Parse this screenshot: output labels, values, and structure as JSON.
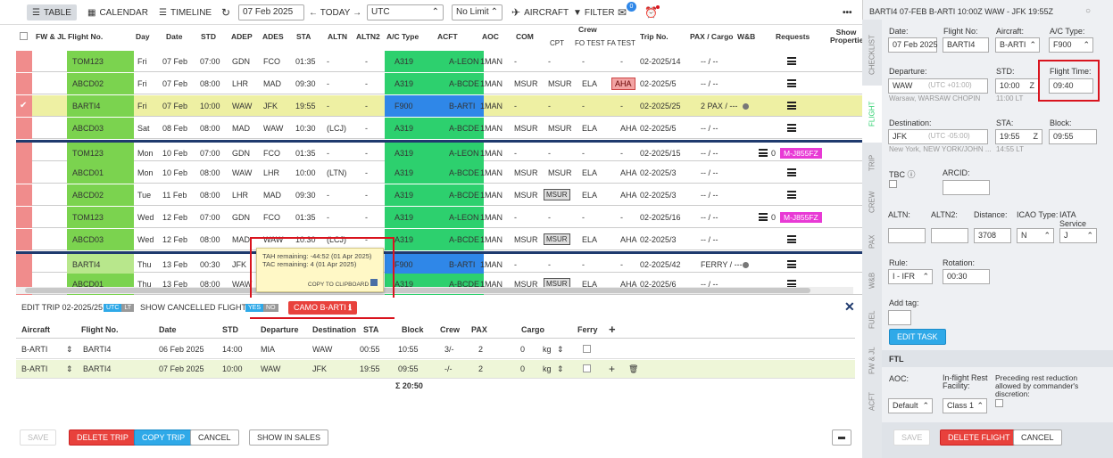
{
  "toolbar": {
    "table": "TABLE",
    "calendar": "CALENDAR",
    "timeline": "TIMELINE",
    "date": "07 Feb 2025",
    "today": "TODAY",
    "tz": "UTC",
    "limit": "No Limit",
    "aircraft": "AIRCRAFT",
    "filter": "FILTER",
    "mail_badge": "0",
    "more": "•••"
  },
  "columns": {
    "fw": "FW & JL",
    "flight": "Flight No.",
    "day": "Day",
    "date": "Date",
    "std": "STD",
    "adep": "ADEP",
    "ades": "ADES",
    "sta": "STA",
    "altn": "ALTN",
    "altn2": "ALTN2",
    "actype": "A/C Type",
    "acft": "ACFT",
    "aoc": "AOC",
    "com": "COM",
    "crew": "Crew",
    "cpt": "CPT",
    "fo": "FO TEST",
    "fa": "FA TEST",
    "trip": "Trip No.",
    "pax": "PAX / Cargo",
    "wb": "W&B",
    "requests": "Requests",
    "show_props": "Show Properties"
  },
  "rows": [
    {
      "flight": "TOM123",
      "day": "Fri",
      "date": "07 Feb",
      "std": "07:00",
      "adep": "GDN",
      "ades": "FCO",
      "sta": "01:35",
      "altn": "-",
      "altn2": "-",
      "type": "A319",
      "acft": "A-LEON",
      "aoc": "1MAN",
      "com": "-",
      "cpt": "-",
      "fo": "-",
      "fa": "-",
      "trip": "02-2025/14",
      "pax": "-- / --",
      "req_count": "",
      "req_tag": ""
    },
    {
      "flight": "ABCD02",
      "day": "Fri",
      "date": "07 Feb",
      "std": "08:00",
      "adep": "LHR",
      "ades": "MAD",
      "sta": "09:30",
      "altn": "-",
      "altn2": "-",
      "type": "A319",
      "acft": "A-BCDE",
      "aoc": "1MAN",
      "com": "MSUR",
      "cpt": "MSUR",
      "fo": "ELA",
      "fa": "AHA",
      "trip": "02-2025/5",
      "pax": "-- / --",
      "req_count": "",
      "req_tag": ""
    },
    {
      "flight": "BARTI4",
      "day": "Fri",
      "date": "07 Feb",
      "std": "10:00",
      "adep": "WAW",
      "ades": "JFK",
      "sta": "19:55",
      "altn": "-",
      "altn2": "-",
      "type": "F900",
      "acft": "B-ARTI",
      "aoc": "1MAN",
      "com": "-",
      "cpt": "-",
      "fo": "-",
      "fa": "-",
      "trip": "02-2025/25",
      "pax": "2 PAX / ---",
      "req_count": "",
      "req_tag": ""
    },
    {
      "flight": "ABCD03",
      "day": "Sat",
      "date": "08 Feb",
      "std": "08:00",
      "adep": "MAD",
      "ades": "WAW",
      "sta": "10:30",
      "altn": "(LCJ)",
      "altn2": "-",
      "type": "A319",
      "acft": "A-BCDE",
      "aoc": "1MAN",
      "com": "MSUR",
      "cpt": "MSUR",
      "fo": "ELA",
      "fa": "AHA",
      "trip": "02-2025/5",
      "pax": "-- / --",
      "req_count": "",
      "req_tag": ""
    },
    {
      "flight": "TOM123",
      "day": "Mon",
      "date": "10 Feb",
      "std": "07:00",
      "adep": "GDN",
      "ades": "FCO",
      "sta": "01:35",
      "altn": "-",
      "altn2": "-",
      "type": "A319",
      "acft": "A-LEON",
      "aoc": "1MAN",
      "com": "-",
      "cpt": "-",
      "fo": "-",
      "fa": "-",
      "trip": "02-2025/15",
      "pax": "-- / --",
      "req_count": "0",
      "req_tag": "M-J855FZ"
    },
    {
      "flight": "ABCD01",
      "day": "Mon",
      "date": "10 Feb",
      "std": "08:00",
      "adep": "WAW",
      "ades": "LHR",
      "sta": "10:00",
      "altn": "(LTN)",
      "altn2": "-",
      "type": "A319",
      "acft": "A-BCDE",
      "aoc": "1MAN",
      "com": "MSUR",
      "cpt": "MSUR",
      "fo": "ELA",
      "fa": "AHA",
      "trip": "02-2025/3",
      "pax": "-- / --",
      "req_count": "",
      "req_tag": ""
    },
    {
      "flight": "ABCD02",
      "day": "Tue",
      "date": "11 Feb",
      "std": "08:00",
      "adep": "LHR",
      "ades": "MAD",
      "sta": "09:30",
      "altn": "-",
      "altn2": "-",
      "type": "A319",
      "acft": "A-BCDE",
      "aoc": "1MAN",
      "com": "MSUR",
      "cpt": "MSUR",
      "fo": "ELA",
      "fa": "AHA",
      "trip": "02-2025/3",
      "pax": "-- / --",
      "req_count": "",
      "req_tag": ""
    },
    {
      "flight": "TOM123",
      "day": "Wed",
      "date": "12 Feb",
      "std": "07:00",
      "adep": "GDN",
      "ades": "FCO",
      "sta": "01:35",
      "altn": "-",
      "altn2": "-",
      "type": "A319",
      "acft": "A-LEON",
      "aoc": "1MAN",
      "com": "-",
      "cpt": "-",
      "fo": "-",
      "fa": "-",
      "trip": "02-2025/16",
      "pax": "-- / --",
      "req_count": "0",
      "req_tag": "M-J855FZ"
    },
    {
      "flight": "ABCD03",
      "day": "Wed",
      "date": "12 Feb",
      "std": "08:00",
      "adep": "MAD",
      "ades": "WAW",
      "sta": "10:30",
      "altn": "(LCJ)",
      "altn2": "-",
      "type": "A319",
      "acft": "A-BCDE",
      "aoc": "1MAN",
      "com": "MSUR",
      "cpt": "MSUR",
      "fo": "ELA",
      "fa": "AHA",
      "trip": "02-2025/3",
      "pax": "-- / --",
      "req_count": "",
      "req_tag": ""
    },
    {
      "flight": "BARTI4",
      "day": "Thu",
      "date": "13 Feb",
      "std": "00:30",
      "adep": "JFK",
      "ades": "",
      "sta": "",
      "altn": "",
      "altn2": "",
      "type": "F900",
      "acft": "B-ARTI",
      "aoc": "1MAN",
      "com": "-",
      "cpt": "-",
      "fo": "-",
      "fa": "-",
      "trip": "02-2025/42",
      "pax": "FERRY / ---",
      "req_count": "",
      "req_tag": ""
    },
    {
      "flight": "ABCD01",
      "day": "Thu",
      "date": "13 Feb",
      "std": "08:00",
      "adep": "WAW",
      "ades": "",
      "sta": "",
      "altn": "",
      "altn2": "",
      "type": "A319",
      "acft": "A-BCDE",
      "aoc": "1MAN",
      "com": "MSUR",
      "cpt": "MSUR",
      "fo": "ELA",
      "fa": "AHA",
      "trip": "02-2025/6",
      "pax": "-- / --",
      "req_count": "",
      "req_tag": ""
    }
  ],
  "tooltip": {
    "line1": "TAH remaining: -44:52 (01 Apr 2025)",
    "line2": "TAC remaining: 4 (01 Apr 2025)",
    "copy": "COPY TO CLIPBOARD"
  },
  "edit": {
    "title": "EDIT TRIP 02-2025/25",
    "utc": "UTC",
    "lt": "LT",
    "show_cancelled": "SHOW CANCELLED FLIGHTS",
    "yes": "YES",
    "no": "NO",
    "camo": "CAMO B-ARTI",
    "headers": {
      "aircraft": "Aircraft",
      "flight": "Flight No.",
      "date": "Date",
      "std": "STD",
      "departure": "Departure",
      "destination": "Destination",
      "sta": "STA",
      "block": "Block",
      "crew": "Crew",
      "pax": "PAX",
      "cargo": "Cargo",
      "ferry": "Ferry"
    },
    "rows": [
      {
        "aircraft": "B-ARTI",
        "flight": "BARTI4",
        "date": "06 Feb 2025",
        "std": "14:00",
        "dep": "MIA",
        "dest": "WAW",
        "sta": "00:55",
        "block": "10:55",
        "crew": "3/-",
        "pax": "2",
        "cargo": "0",
        "unit": "kg"
      },
      {
        "aircraft": "B-ARTI",
        "flight": "BARTI4",
        "date": "07 Feb 2025",
        "std": "10:00",
        "dep": "WAW",
        "dest": "JFK",
        "sta": "19:55",
        "block": "09:55",
        "crew": "-/-",
        "pax": "2",
        "cargo": "0",
        "unit": "kg"
      }
    ],
    "total": "Σ 20:50"
  },
  "buttons": {
    "save": "SAVE",
    "delete_trip": "DELETE TRIP",
    "copy_trip": "COPY TRIP",
    "cancel": "CANCEL",
    "show_in_sales": "SHOW IN SALES"
  },
  "panel": {
    "title": "BARTI4 07-FEB B-ARTI 10:00Z WAW - JFK 19:55Z",
    "tabs": [
      "CHECKLIST",
      "FLIGHT",
      "TRIP",
      "CREW",
      "PAX",
      "W&B",
      "FUEL",
      "FW & JL",
      "ACFT"
    ],
    "date_lbl": "Date:",
    "date": "07 Feb 2025",
    "flightno_lbl": "Flight No:",
    "flightno": "BARTI4",
    "aircraft_lbl": "Aircraft:",
    "aircraft": "B-ARTI",
    "actype_lbl": "A/C Type:",
    "actype": "F900",
    "departure_lbl": "Departure:",
    "departure": "WAW",
    "dep_tz": "(UTC +01:00)",
    "dep_name": "Warsaw, WARSAW CHOPIN",
    "std_lbl": "STD:",
    "std": "10:00",
    "std_z": "Z",
    "std_lt": "11:00 LT",
    "flighttime_lbl": "Flight Time:",
    "flighttime": "09:40",
    "destination_lbl": "Destination:",
    "destination": "JFK",
    "dest_tz": "(UTC -05:00)",
    "dest_name": "New York, NEW YORK/JOHN ...",
    "sta_lbl": "STA:",
    "sta": "19:55",
    "sta_z": "Z",
    "sta_lt": "14:55 LT",
    "block_lbl": "Block:",
    "block": "09:55",
    "tbc_lbl": "TBC",
    "arcid_lbl": "ARCID:",
    "altn_lbl": "ALTN:",
    "altn2_lbl": "ALTN2:",
    "distance_lbl": "Distance:",
    "distance": "3708",
    "icao_lbl": "ICAO Type:",
    "icao": "N",
    "iata_lbl": "IATA Service Type:",
    "iata": "J",
    "rule_lbl": "Rule:",
    "rule": "I - IFR",
    "rotation_lbl": "Rotation:",
    "rotation": "00:30",
    "addtag_lbl": "Add tag:",
    "edit_task": "EDIT TASK",
    "ftl": "FTL",
    "aoc_lbl": "AOC:",
    "aoc": "Default",
    "rest_lbl": "In-flight Rest Facility:",
    "rest": "Class 1",
    "reduction_lbl": "Preceding rest reduction allowed by commander's discretion:",
    "save": "SAVE",
    "delete_flight": "DELETE FLIGHT",
    "cancel": "CANCEL"
  }
}
